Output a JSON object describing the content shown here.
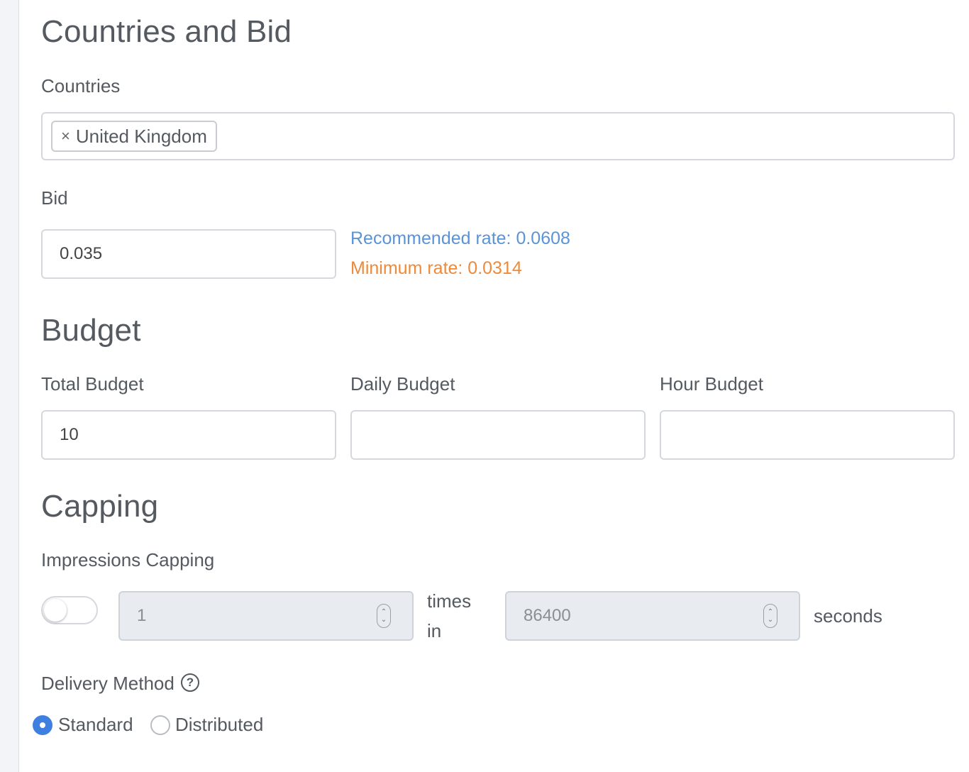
{
  "countries_section": {
    "title": "Countries and Bid",
    "countries_label": "Countries",
    "selected_countries": [
      "United Kingdom"
    ],
    "tag_remove_glyph": "×",
    "bid_label": "Bid",
    "bid_value": "0.035",
    "recommended_rate": "Recommended rate: 0.0608",
    "minimum_rate": "Minimum rate: 0.0314",
    "recommended_color": "#5b93d8",
    "minimum_color": "#ee8a3a"
  },
  "budget_section": {
    "title": "Budget",
    "total_label": "Total Budget",
    "total_value": "10",
    "daily_label": "Daily Budget",
    "daily_value": "",
    "hour_label": "Hour Budget",
    "hour_value": ""
  },
  "capping_section": {
    "title": "Capping",
    "impressions_label": "Impressions Capping",
    "toggle_on": false,
    "times_value": "1",
    "times_word": "times",
    "in_word": "in",
    "seconds_value": "86400",
    "seconds_word": "seconds"
  },
  "delivery": {
    "label": "Delivery Method",
    "help_icon": "question-circle-icon",
    "help_glyph": "?",
    "options": [
      {
        "label": "Standard",
        "checked": true
      },
      {
        "label": "Distributed",
        "checked": false
      }
    ],
    "accent_color": "#3f7fe0"
  }
}
